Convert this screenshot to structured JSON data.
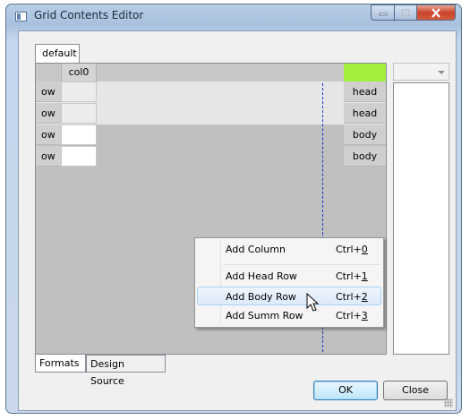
{
  "window": {
    "title": "Grid Contents Editor",
    "icon": "app-window-icon"
  },
  "caption_buttons": {
    "minimize": "minimize-icon",
    "maximize": "maximize-icon",
    "close": "close-icon"
  },
  "top_tab": {
    "label": "default"
  },
  "grid": {
    "column_header": "col0",
    "rows": [
      {
        "header": "ow",
        "label": "head"
      },
      {
        "header": "ow",
        "label": "head"
      },
      {
        "header": "ow",
        "label": "body"
      },
      {
        "header": "ow",
        "label": "body"
      }
    ]
  },
  "colors": {
    "selected_column_accent": "#a2f03c",
    "divider": "#1a35d6",
    "highlight_border": "#a8d1f4"
  },
  "context_menu": {
    "items": [
      {
        "label": "Add Column",
        "shortcut_prefix": "Ctrl+",
        "shortcut_key": "0"
      },
      {
        "label": "Add Head Row",
        "shortcut_prefix": "Ctrl+",
        "shortcut_key": "1"
      },
      {
        "label": "Add Body Row",
        "shortcut_prefix": "Ctrl+",
        "shortcut_key": "2"
      },
      {
        "label": "Add Summ Row",
        "shortcut_prefix": "Ctrl+",
        "shortcut_key": "3"
      }
    ],
    "highlighted_item": "Add Body Row"
  },
  "bottom_tabs": [
    {
      "label": "Formats"
    },
    {
      "label": "Design Source"
    }
  ],
  "buttons": {
    "ok": "OK",
    "close": "Close"
  }
}
